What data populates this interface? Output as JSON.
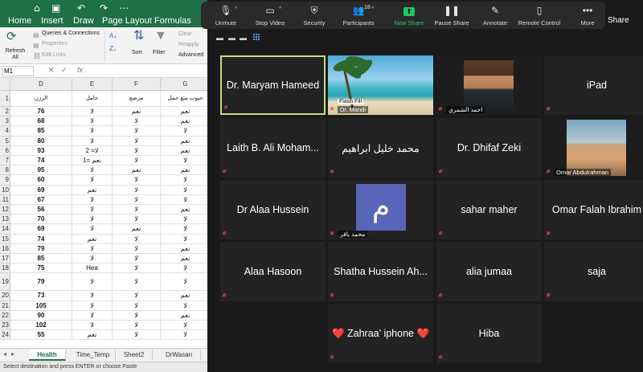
{
  "excel": {
    "title_icons": [
      "home-icon",
      "save-icon",
      "undo-icon",
      "redo-icon",
      "more-icon"
    ],
    "tabs": [
      "Home",
      "Insert",
      "Draw",
      "Page Layout",
      "Formulas"
    ],
    "ribbon": {
      "refresh_all": "Refresh All",
      "queries_connections": "Queries & Connections",
      "properties": "Properties",
      "edit_links": "Edit Links",
      "sort": "Sort",
      "filter": "Filter",
      "clear": "Clear",
      "reapply": "Reapply",
      "advanced": "Advanced"
    },
    "formula_bar": {
      "name_box": "M1",
      "fx": "fx",
      "value": ""
    },
    "columns": [
      "D",
      "E",
      "F",
      "G"
    ],
    "rows": [
      {
        "n": "1",
        "cells": [
          "الرزن",
          "حامل",
          "مرضع",
          "حبوب منع حمل"
        ]
      },
      {
        "n": "2",
        "cells": [
          "76",
          "لا",
          "نعم",
          "نعم"
        ]
      },
      {
        "n": "3",
        "cells": [
          "68",
          "لا",
          "لا",
          "نعم"
        ]
      },
      {
        "n": "4",
        "cells": [
          "85",
          "لا",
          "لا",
          "لا"
        ]
      },
      {
        "n": "5",
        "cells": [
          "80",
          "لا",
          "لا",
          "نعم"
        ]
      },
      {
        "n": "6",
        "cells": [
          "93",
          "2 =لا",
          "لا",
          "نعم"
        ]
      },
      {
        "n": "7",
        "cells": [
          "74",
          "1= نعم",
          "لا",
          "لا"
        ]
      },
      {
        "n": "8",
        "cells": [
          "95",
          "لا",
          "نعم",
          "نعم"
        ]
      },
      {
        "n": "9",
        "cells": [
          "60",
          "لا",
          "لا",
          "لا"
        ]
      },
      {
        "n": "10",
        "cells": [
          "69",
          "نعم",
          "لا",
          "لا"
        ]
      },
      {
        "n": "11",
        "cells": [
          "67",
          "لا",
          "لا",
          "لا"
        ]
      },
      {
        "n": "12",
        "cells": [
          "56",
          "لا",
          "لا",
          "نعم"
        ]
      },
      {
        "n": "13",
        "cells": [
          "70",
          "لا",
          "لا",
          "لا"
        ]
      },
      {
        "n": "14",
        "cells": [
          "69",
          "لا",
          "نعم",
          "لا"
        ]
      },
      {
        "n": "15",
        "cells": [
          "74",
          "نعم",
          "لا",
          "لا"
        ]
      },
      {
        "n": "16",
        "cells": [
          "79",
          "لا",
          "لا",
          "نعم"
        ]
      },
      {
        "n": "17",
        "cells": [
          "85",
          "لا",
          "لا",
          "نعم"
        ]
      },
      {
        "n": "18",
        "cells": [
          "75",
          "Hea",
          "لا",
          "لا"
        ]
      },
      {
        "n": "19",
        "cells": [
          "79",
          "لا",
          "لا",
          "لا"
        ]
      },
      {
        "n": "20",
        "cells": [
          "73",
          "لا",
          "لا",
          "نعم"
        ]
      },
      {
        "n": "21",
        "cells": [
          "105",
          "لا",
          "لا",
          "لا"
        ]
      },
      {
        "n": "22",
        "cells": [
          "90",
          "لا",
          "لا",
          "نعم"
        ]
      },
      {
        "n": "23",
        "cells": [
          "102",
          "لا",
          "لا",
          "لا"
        ]
      },
      {
        "n": "24",
        "cells": [
          "55",
          "نعم",
          "لا",
          "لا"
        ]
      }
    ],
    "sheets": [
      "Health",
      "Time_Temp",
      "Sheet2",
      "DrWasan"
    ],
    "active_sheet": "Health",
    "status": "Select destination and press ENTER or choose Paste"
  },
  "zoom": {
    "toolbar": [
      {
        "label": "Unmute",
        "icon": "mic-muted-icon"
      },
      {
        "label": "Stop Video",
        "icon": "video-icon"
      },
      {
        "label": "Security",
        "icon": "shield-icon"
      },
      {
        "label": "Participants",
        "icon": "participants-icon",
        "count": "18"
      },
      {
        "label": "New Share",
        "icon": "share-screen-icon"
      },
      {
        "label": "Pause Share",
        "icon": "pause-icon"
      },
      {
        "label": "Annotate",
        "icon": "pencil-icon"
      },
      {
        "label": "Remote Control",
        "icon": "mouse-icon"
      },
      {
        "label": "More",
        "icon": "more-icon"
      }
    ],
    "share_label": "Share",
    "participants": [
      {
        "name": "Dr. Maryam Hameed",
        "active": true
      },
      {
        "name": "",
        "label": "Dr. Mandi",
        "badge": "Flash Fill",
        "type": "beach"
      },
      {
        "name": "",
        "label": "احمد الشمري",
        "type": "face1"
      },
      {
        "name": "iPad"
      },
      {
        "name": "Laith B. Ali Moham..."
      },
      {
        "name": "محمد خليل ابراهيم"
      },
      {
        "name": "Dr. Dhifaf Zeki"
      },
      {
        "name": "",
        "label": "Omar Abdulrahman",
        "type": "face2"
      },
      {
        "name": "Dr Alaa Hussein"
      },
      {
        "name": "",
        "label": "محمد باقر",
        "type": "avatar",
        "initial": "م"
      },
      {
        "name": "sahar maher"
      },
      {
        "name": "Omar Falah Ibrahim"
      },
      {
        "name": "Alaa Hasoon"
      },
      {
        "name": "Shatha Hussein Ah..."
      },
      {
        "name": "alia jumaa"
      },
      {
        "name": "saja"
      },
      {
        "name": "❤️ Zahraa' iphone ❤️"
      },
      {
        "name": "Hiba"
      }
    ],
    "mic_muted_color": "#e34a4a",
    "active_speaker_color": "#c6d982",
    "share_color": "#22c55e"
  }
}
